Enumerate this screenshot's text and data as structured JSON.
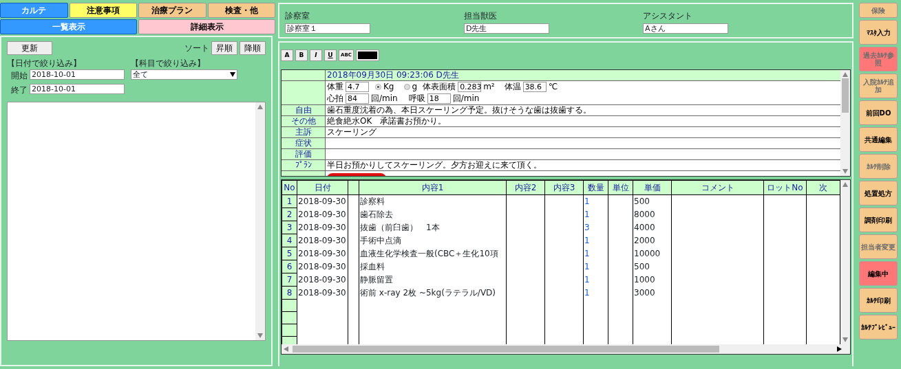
{
  "tabs_top": [
    {
      "label": "カルテ",
      "selected": true,
      "color": "#3399ff"
    },
    {
      "label": "注意事項",
      "selected": false,
      "color": "#ffff66"
    },
    {
      "label": "治療プラン",
      "selected": false,
      "color": "#f5c98c"
    },
    {
      "label": "検査・他",
      "selected": false,
      "color": "#f5c98c"
    }
  ],
  "tabs_view": [
    {
      "label": "一覧表示",
      "selected": true,
      "color": "#3399ff"
    },
    {
      "label": "詳細表示",
      "selected": false,
      "color": "#ffc8d0"
    }
  ],
  "list_panel": {
    "refresh_button": "更新",
    "sort_label": "ソート",
    "sort_buttons": [
      "昇順",
      "降順"
    ],
    "date_filter": {
      "title": "【日付で絞り込み】",
      "start_label": "開始",
      "start_value": "2018-10-01",
      "end_label": "終了",
      "end_value": "2018-10-01"
    },
    "subject_filter": {
      "title": "【科目で絞り込み】",
      "value": "全て"
    }
  },
  "header": [
    {
      "label": "診察室",
      "value": "診察室１"
    },
    {
      "label": "担当獣医",
      "value": "D先生"
    },
    {
      "label": "アシスタント",
      "value": "Aさん"
    }
  ],
  "format_toolbar": [
    "A",
    "B",
    "I",
    "U",
    "ABC"
  ],
  "record": {
    "timestamp": "2018年09月30日 09:23:06 D先生",
    "vitals": {
      "weight_label": "体重",
      "weight": "4.7",
      "units": [
        {
          "label": "Kg",
          "selected": true
        },
        {
          "label": "g",
          "selected": false
        }
      ],
      "bsa_label": "体表面積",
      "bsa": "0.283",
      "bsa_unit": "m²",
      "temp_label": "体温",
      "temp": "38.6",
      "temp_unit": "℃",
      "hr_label": "心拍",
      "hr": "84",
      "hr_unit": "回/min",
      "rr_label": "呼吸",
      "rr": "18",
      "rr_unit": "回/min"
    },
    "rows": [
      {
        "label": "自由",
        "text": "歯石重度沈着の為、本日スケーリング予定。抜けそうな歯は抜歯する。"
      },
      {
        "label": "その他",
        "text": "絶食絶水OK　承諾書お預かり。"
      },
      {
        "label": "主訴",
        "text": "スケーリング"
      },
      {
        "label": "症状",
        "text": ""
      },
      {
        "label": "評価",
        "text": ""
      },
      {
        "label": "ﾌﾟﾗﾝ",
        "text": "半日お預かりしてスケーリング。夕方お迎えに来て頂く。"
      }
    ]
  },
  "items_table": {
    "columns": [
      "No",
      "日付",
      "",
      "内容1",
      "内容2",
      "内容3",
      "数量",
      "単位",
      "単価",
      "コメント",
      "ロットNo",
      "次"
    ],
    "rows": [
      [
        "1",
        "2018-09-30",
        "",
        "診察料",
        "",
        "",
        "1",
        "",
        "500",
        "",
        "",
        ""
      ],
      [
        "2",
        "2018-09-30",
        "",
        "歯石除去",
        "",
        "",
        "1",
        "",
        "8000",
        "",
        "",
        ""
      ],
      [
        "3",
        "2018-09-30",
        "",
        "抜歯（前臼歯）　1本",
        "",
        "",
        "3",
        "",
        "4000",
        "",
        "",
        ""
      ],
      [
        "4",
        "2018-09-30",
        "",
        "手術中点滴",
        "",
        "",
        "1",
        "",
        "2000",
        "",
        "",
        ""
      ],
      [
        "5",
        "2018-09-30",
        "",
        "血液生化学検査一般(CBC＋生化10項",
        "",
        "",
        "1",
        "",
        "10000",
        "",
        "",
        ""
      ],
      [
        "6",
        "2018-09-30",
        "",
        "採血料",
        "",
        "",
        "1",
        "",
        "500",
        "",
        "",
        ""
      ],
      [
        "7",
        "2018-09-30",
        "",
        "静脈留置",
        "",
        "",
        "1",
        "",
        "1000",
        "",
        "",
        ""
      ],
      [
        "8",
        "2018-09-30",
        "",
        "術前 x-ray 2枚 ~5kg(ラテラル/VD)",
        "",
        "",
        "1",
        "",
        "3000",
        "",
        "",
        ""
      ]
    ]
  },
  "side_buttons": [
    {
      "label": "保険",
      "disabled": true,
      "highlighted": false
    },
    {
      "label": "ﾏｽﾀ入力",
      "disabled": false,
      "highlighted": false
    },
    {
      "label": "過去ｶﾙﾃ参照",
      "disabled": true,
      "highlighted": true
    },
    {
      "label": "入院ｶﾙﾃ追加",
      "disabled": true,
      "highlighted": false
    },
    {
      "label": "前回DO",
      "disabled": false,
      "highlighted": false
    },
    {
      "label": "共通編集",
      "disabled": false,
      "highlighted": false
    },
    {
      "label": "ｶﾙﾃ削除",
      "disabled": true,
      "highlighted": false
    },
    {
      "label": "処置処方",
      "disabled": false,
      "highlighted": false
    },
    {
      "label": "調剤印刷",
      "disabled": false,
      "highlighted": false
    },
    {
      "label": "担当者変更",
      "disabled": true,
      "highlighted": false
    },
    {
      "label": "編集中",
      "disabled": false,
      "highlighted": true
    },
    {
      "label": "ｶﾙﾃ印刷",
      "disabled": false,
      "highlighted": false
    },
    {
      "label": "ｶﾙﾃﾌﾟﾚﾋﾞｭｰ",
      "disabled": false,
      "highlighted": false
    }
  ]
}
